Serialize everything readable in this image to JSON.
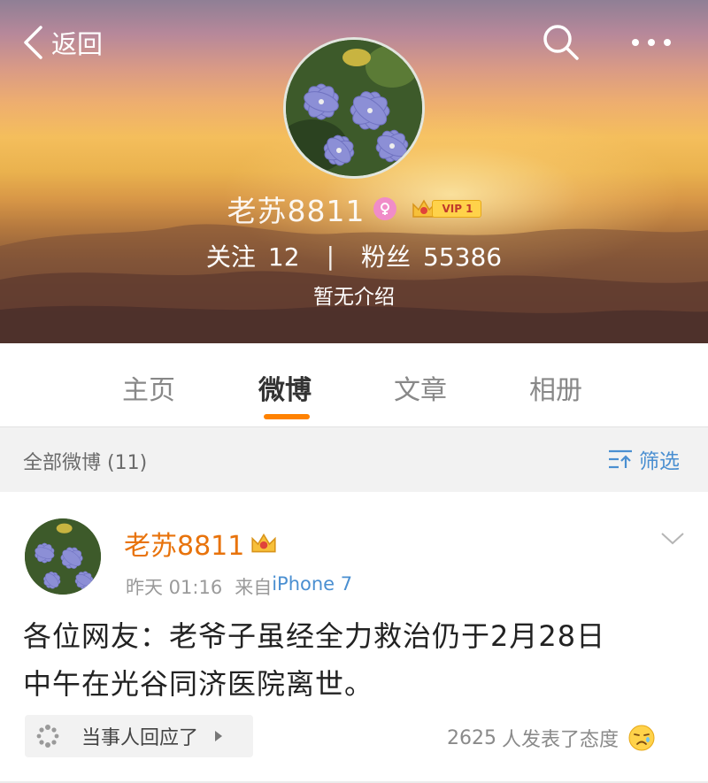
{
  "header": {
    "back_label": "返回",
    "icons": {
      "back": "chevron-left-icon",
      "search": "search-icon",
      "more": "more-dots-icon"
    }
  },
  "profile": {
    "name": "老苏8811",
    "gender_badge": "female-icon",
    "vip_label": "VIP 1",
    "following_label": "关注",
    "following_count": "12",
    "separator": "|",
    "followers_label": "粉丝",
    "followers_count": "55386",
    "bio": "暂无介绍"
  },
  "tabs": [
    {
      "label": "主页",
      "active": false
    },
    {
      "label": "微博",
      "active": true
    },
    {
      "label": "文章",
      "active": false
    },
    {
      "label": "相册",
      "active": false
    }
  ],
  "filter_bar": {
    "count_label": "全部微博 (11)",
    "filter_label": "筛选"
  },
  "post": {
    "author": "老苏8811",
    "time": "昨天 01:16",
    "source_prefix": "来自",
    "source": "iPhone 7",
    "text_line1": "各位网友：老爷子虽经全力救治仍于2月28日",
    "text_line2": "中午在光谷同济医院离世。",
    "related_label": "当事人回应了",
    "reaction_count": "2625",
    "reaction_text": "人发表了态度"
  },
  "colors": {
    "accent_orange": "#ff8200",
    "author_orange": "#e8730c",
    "link_blue": "#4a8fd1"
  }
}
